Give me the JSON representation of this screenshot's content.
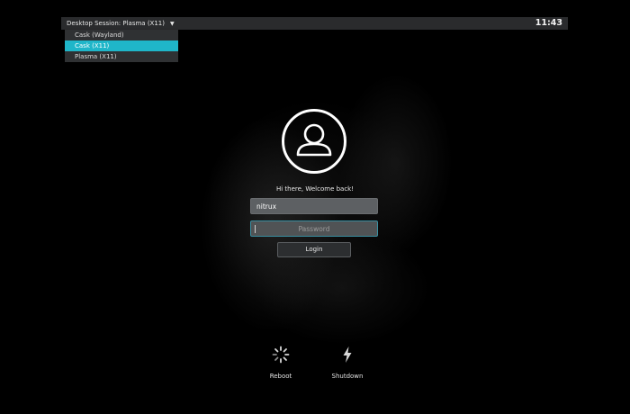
{
  "topbar": {
    "session_label": "Desktop Session: Plasma (X11)",
    "caret_icon": "caret-down-icon",
    "clock": "11:43"
  },
  "session_menu": {
    "options": [
      "Cask (Wayland)",
      "Cask (X11)",
      "Plasma (X11)"
    ],
    "highlighted": "Cask (X11)"
  },
  "login": {
    "avatar_icon": "user-icon",
    "greeting": "Hi there, Welcome back!",
    "username": "nitrux",
    "password_placeholder": "Password",
    "login_label": "Login"
  },
  "power": {
    "reboot_label": "Reboot",
    "reboot_icon": "spinner-reboot-icon",
    "shutdown_label": "Shutdown",
    "shutdown_icon": "lightning-bolt-icon"
  },
  "colors": {
    "accent": "#1fb6c9",
    "topbar_bg": "#2a2b2d",
    "field_bg": "#5d6063"
  }
}
